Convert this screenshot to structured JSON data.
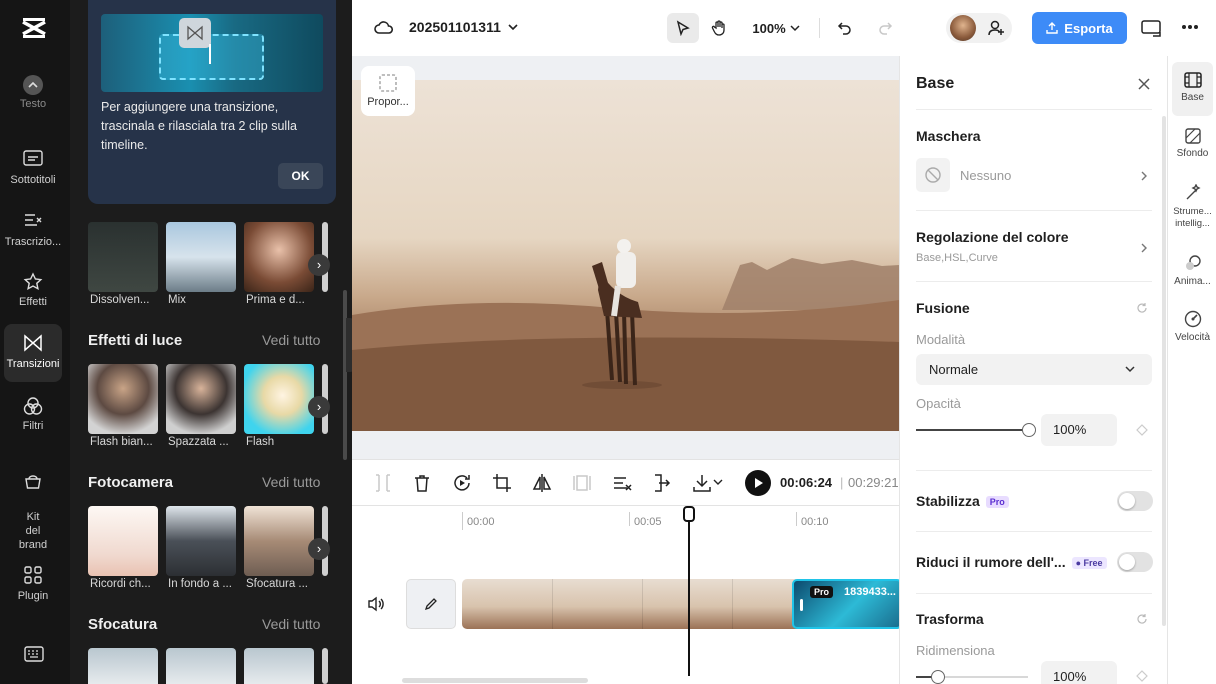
{
  "rail": {
    "items": [
      {
        "label": "Testo",
        "icon": "text-icon"
      },
      {
        "label": "Sottotitoli",
        "icon": "subtitles-icon"
      },
      {
        "label": "Trascrizio...",
        "icon": "transcript-icon"
      },
      {
        "label": "Effetti",
        "icon": "effects-icon"
      },
      {
        "label": "Transizioni",
        "icon": "transitions-icon"
      },
      {
        "label": "Filtri",
        "icon": "filters-icon"
      },
      {
        "label": "Kit\ndel\nbrand",
        "icon": "brand-kit-icon"
      },
      {
        "label": "Plugin",
        "icon": "plugin-icon"
      }
    ]
  },
  "panel": {
    "tip_text": "Per aggiungere una transizione, trascinala e rilasciala tra 2 clip sulla timeline.",
    "ok_label": "OK",
    "see_all": "Vedi tutto",
    "top_row": [
      "Dissolven...",
      "Mix",
      "Prima e d..."
    ],
    "sections": [
      {
        "title": "Effetti di luce",
        "items": [
          "Flash bian...",
          "Spazzata ...",
          "Flash"
        ]
      },
      {
        "title": "Fotocamera",
        "items": [
          "Ricordi ch...",
          "In fondo a ...",
          "Sfocatura ..."
        ]
      },
      {
        "title": "Sfocatura",
        "items": []
      }
    ]
  },
  "topbar": {
    "project_title": "202501101311",
    "zoom": "100%",
    "export_label": "Esporta"
  },
  "stage": {
    "aspect_label": "Propor..."
  },
  "player": {
    "current_time": "00:06:24",
    "total_time": "00:29:21"
  },
  "timeline": {
    "ticks": [
      "00:00",
      "00:05",
      "00:10"
    ],
    "clip_badge": "Pro",
    "clip_id": "1839433..."
  },
  "props": {
    "title": "Base",
    "mask": {
      "heading": "Maschera",
      "value": "Nessuno"
    },
    "color": {
      "heading": "Regolazione del colore",
      "sub": "Base,HSL,Curve"
    },
    "blend": {
      "heading": "Fusione",
      "mode_label": "Modalità",
      "mode_value": "Normale",
      "opacity_label": "Opacità",
      "opacity_value": "100%",
      "opacity": 1.0
    },
    "stabilize": {
      "heading": "Stabilizza",
      "badge": "Pro"
    },
    "denoise": {
      "heading": "Riduci il rumore dell'...",
      "badge": "Free"
    },
    "transform": {
      "heading": "Trasforma",
      "resize_label": "Ridimensiona",
      "resize_value": "100%"
    }
  },
  "tabs": [
    {
      "label": "Base"
    },
    {
      "label": "Sfondo"
    },
    {
      "label": "Strume... intellig..."
    },
    {
      "label": "Anima..."
    },
    {
      "label": "Velocità"
    }
  ],
  "colors": {
    "accent": "#3d8bf7",
    "rail_bg": "#151515",
    "panel_bg": "#1c1c1c",
    "clip_selected": "#20c4e8"
  }
}
